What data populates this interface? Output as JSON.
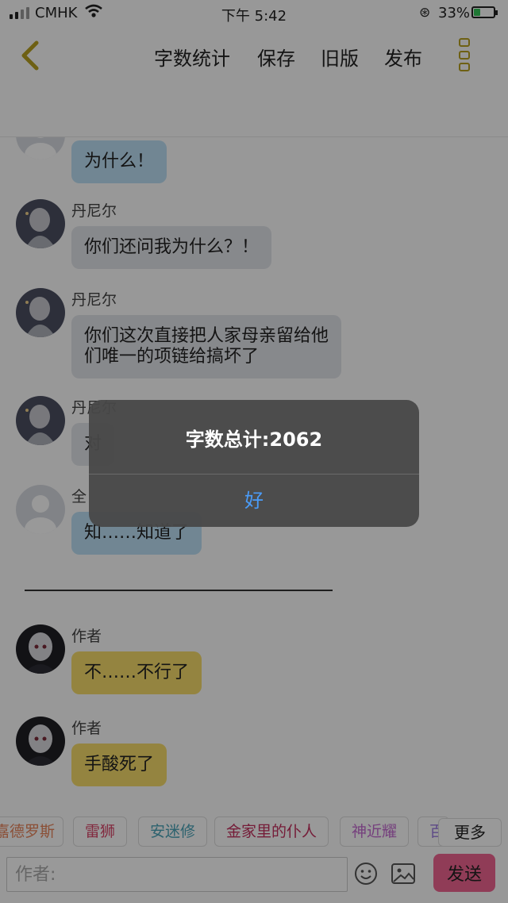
{
  "status_bar": {
    "carrier": "CMHK",
    "time": "下午 5:42",
    "battery": "33%",
    "battery_level": 0.33
  },
  "top_nav": {
    "word_count": "字数统计",
    "save": "保存",
    "old_version": "旧版",
    "publish": "发布"
  },
  "messages": [
    {
      "sender": "",
      "text": "为什么！",
      "style": "blue"
    },
    {
      "sender": "丹尼尔",
      "text": "你们还问我为什么？！",
      "style": "gray"
    },
    {
      "sender": "丹尼尔",
      "lines": [
        "你们这次直接把人家母亲留给他",
        "们唯一的项链给搞坏了"
      ],
      "style": "gray"
    },
    {
      "sender": "丹尼尔",
      "text": "对",
      "style": "gray"
    },
    {
      "sender": "全",
      "text": "知……知道了",
      "style": "blue"
    },
    {
      "sender": "作者",
      "text": "不……不行了",
      "style": "yellow"
    },
    {
      "sender": "作者",
      "text": "手酸死了",
      "style": "yellow"
    }
  ],
  "tags": [
    {
      "label": "嘉德罗斯",
      "color": "#e8845a"
    },
    {
      "label": "雷狮",
      "color": "#d9476a"
    },
    {
      "label": "安迷修",
      "color": "#4aa3b8"
    },
    {
      "label": "金家里的仆人",
      "color": "#c4305e"
    },
    {
      "label": "神近耀",
      "color": "#c46ad0"
    },
    {
      "label": "百",
      "color": "#9b7be0"
    }
  ],
  "more_tags": "更多",
  "input": {
    "placeholder": "作者:",
    "value": ""
  },
  "send": "发送",
  "alert": {
    "message": "字数总计:2062",
    "ok": "好"
  }
}
